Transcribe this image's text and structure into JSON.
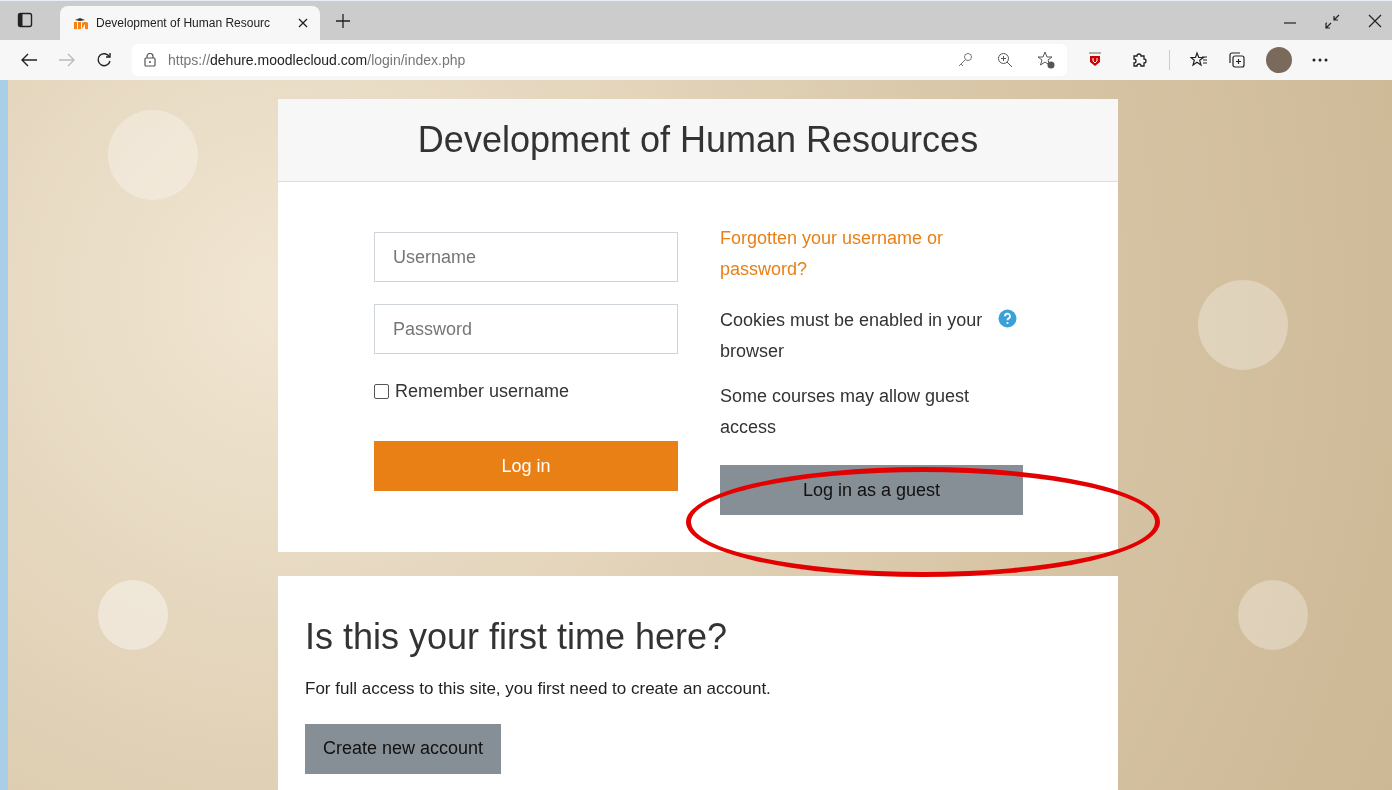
{
  "browser": {
    "tab_title": "Development of Human Resourc",
    "url": {
      "scheme": "https://",
      "host": "dehure.moodlecloud.com",
      "path": "/login/index.php"
    }
  },
  "login": {
    "site_title": "Development of Human Resources",
    "username": {
      "placeholder": "Username"
    },
    "password": {
      "placeholder": "Password"
    },
    "remember": {
      "label": "Remember username",
      "checked": false
    },
    "login_button": "Log in",
    "forgot_link": "Forgotten your username or password?",
    "cookies_note": "Cookies must be enabled in your browser",
    "guest_note": "Some courses may allow guest access",
    "guest_button": "Log in as a guest"
  },
  "signup": {
    "heading": "Is this your first time here?",
    "text": "For full access to this site, you first need to create an account.",
    "button": "Create new account"
  }
}
